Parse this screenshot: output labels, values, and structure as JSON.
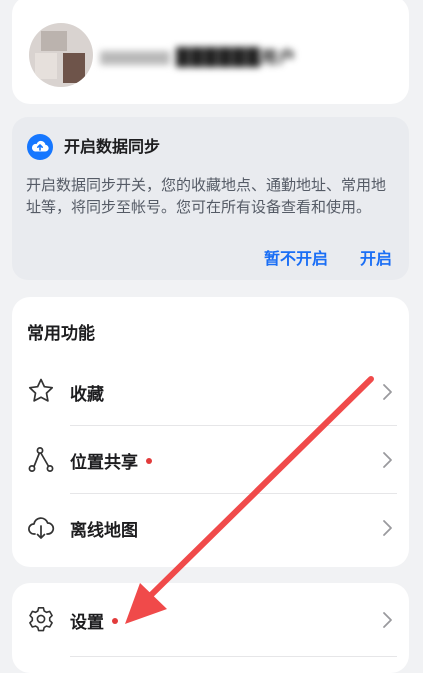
{
  "profile": {
    "username": "██████用户"
  },
  "sync": {
    "title": "开启数据同步",
    "description": "开启数据同步开关，您的收藏地点、通勤地址、常用地址等，将同步至帐号。您可在所有设备查看和使用。",
    "skip_label": "暂不开启",
    "enable_label": "开启",
    "icon": "cloud-upload-icon"
  },
  "common": {
    "title": "常用功能",
    "items": [
      {
        "label": "收藏",
        "icon": "star-icon",
        "badge": false
      },
      {
        "label": "位置共享",
        "icon": "share-location-icon",
        "badge": true
      },
      {
        "label": "离线地图",
        "icon": "cloud-download-icon",
        "badge": false
      }
    ]
  },
  "settings": {
    "label": "设置",
    "icon": "gear-icon",
    "badge": true
  },
  "colors": {
    "accent": "#1a6ef5",
    "badge": "#e23b3b",
    "annotation_arrow": "#f04a4a"
  }
}
